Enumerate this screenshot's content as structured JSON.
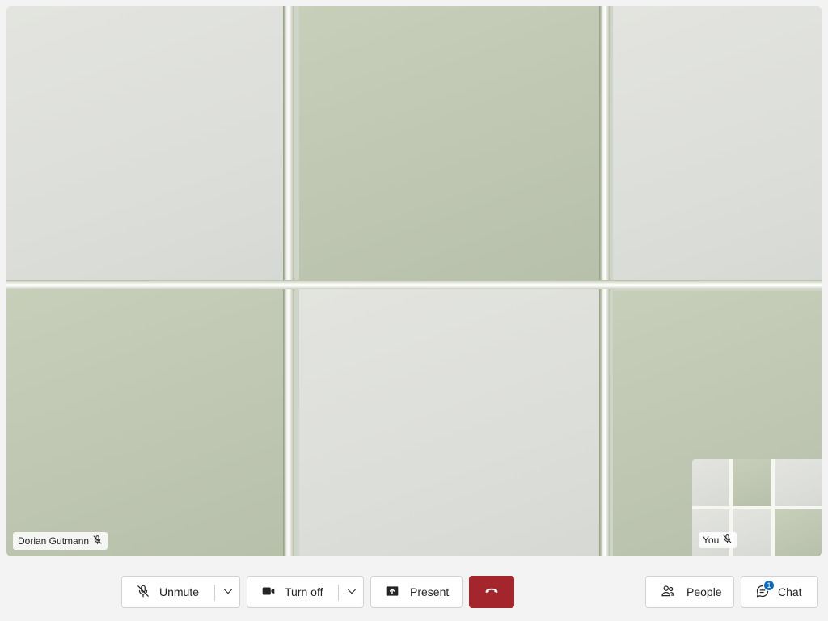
{
  "participant": {
    "name": "Dorian Gutmann",
    "mic_icon": "mic-off-icon"
  },
  "self_view": {
    "label": "You",
    "mic_icon": "mic-off-icon"
  },
  "toolbar": {
    "mic": {
      "label": "Unmute",
      "icon": "mic-off-icon"
    },
    "camera": {
      "label": "Turn off",
      "icon": "video-camera-icon"
    },
    "present": {
      "label": "Present",
      "icon": "share-screen-icon"
    },
    "leave": {
      "icon": "hang-up-icon",
      "color": "#a4262c"
    },
    "people": {
      "label": "People",
      "icon": "people-icon"
    },
    "chat": {
      "label": "Chat",
      "icon": "chat-icon",
      "badge": "1"
    }
  },
  "colors": {
    "accent": "#0f6cbd",
    "hangup": "#a4262c"
  }
}
